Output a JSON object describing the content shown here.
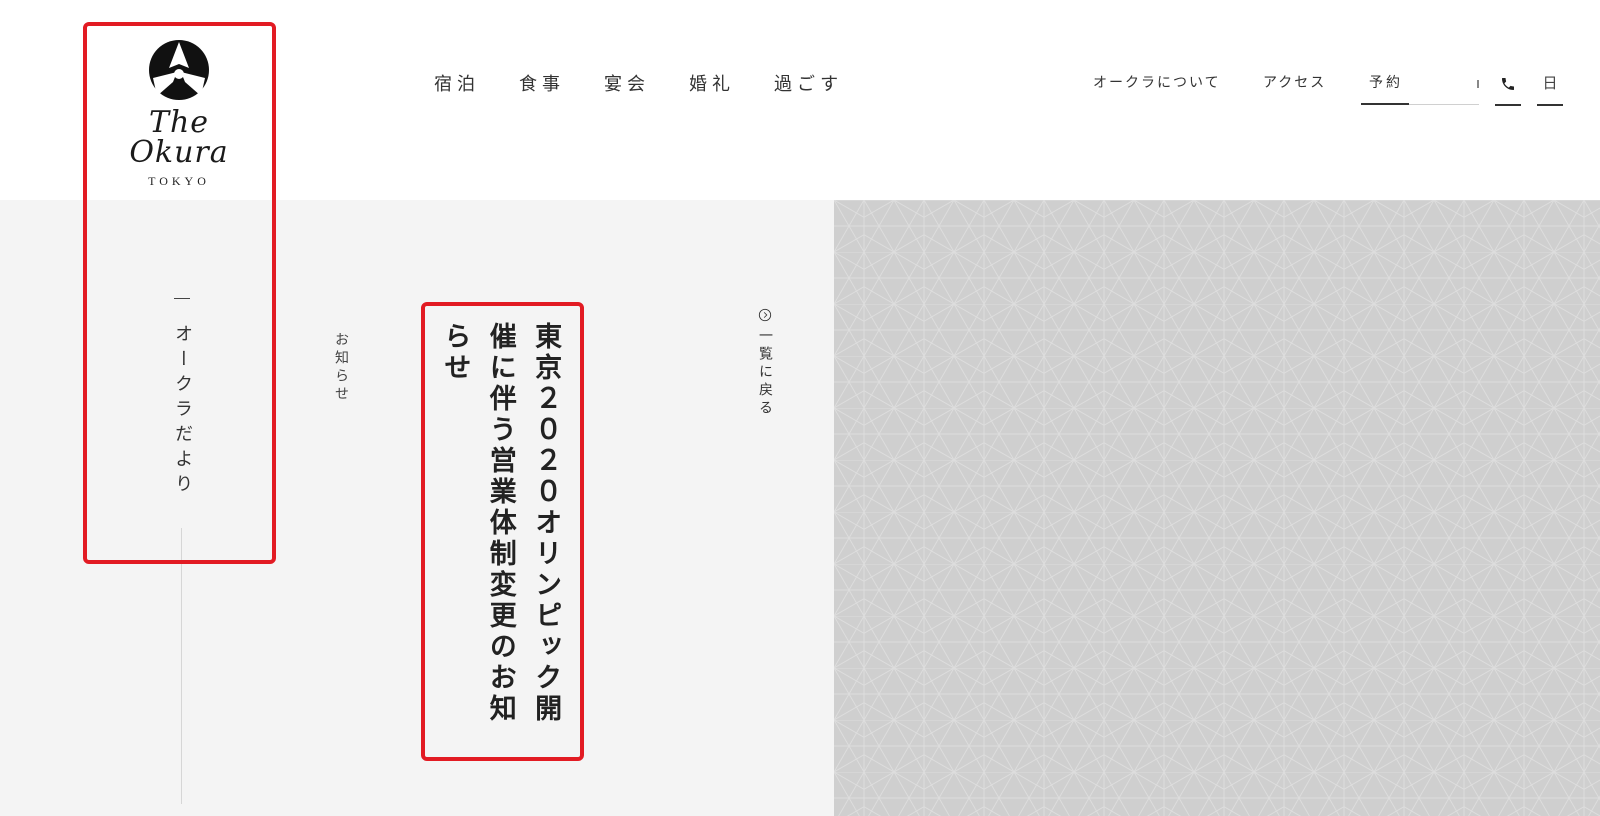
{
  "brand": {
    "name": "The Okura",
    "sub": "TOKYO"
  },
  "main_nav": [
    "宿泊",
    "食事",
    "宴会",
    "婚礼",
    "過ごす"
  ],
  "sub_nav": {
    "about": "オークラについて",
    "access": "アクセス",
    "reserve": "予約"
  },
  "phone_icon": "phone-icon",
  "language": "日",
  "category": "オークラだより",
  "section": "お知らせ",
  "article": {
    "title": "東京２０２０オリンピック開催に伴う営業体制変更のお知らせ"
  },
  "back": {
    "label": "一覧に戻る",
    "icon": "circle-arrow-icon"
  },
  "colors": {
    "highlight": "#e21b23",
    "content_bg": "#f4f4f4",
    "pattern_bg": "#cfcfcf"
  }
}
